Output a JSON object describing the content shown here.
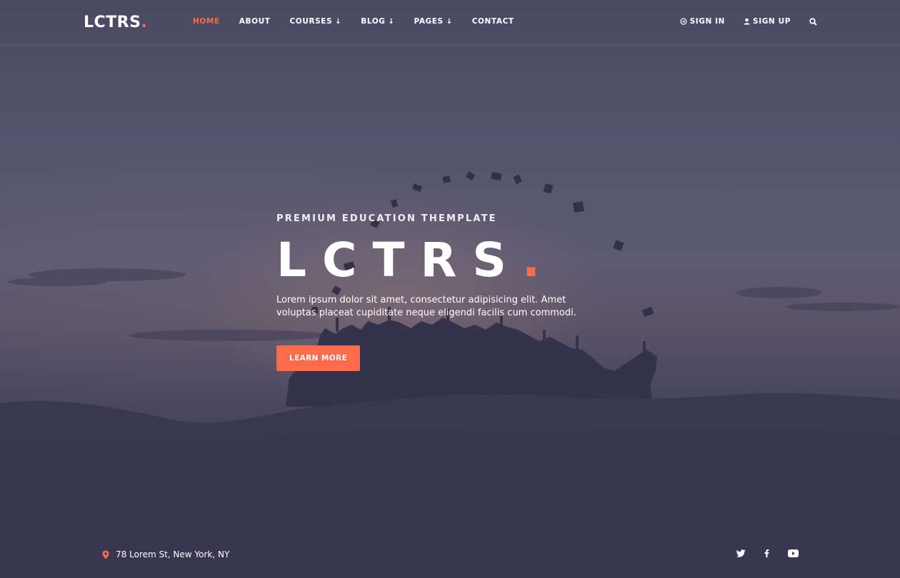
{
  "brand": {
    "name": "LCTRS",
    "dot": ".",
    "accent": "#ff6b4a"
  },
  "nav": {
    "items": [
      {
        "label": "HOME",
        "active": true
      },
      {
        "label": "ABOUT",
        "dropdown": false
      },
      {
        "label": "COURSES",
        "dropdown": true
      },
      {
        "label": "BLOG",
        "dropdown": true
      },
      {
        "label": "PAGES",
        "dropdown": true
      },
      {
        "label": "CONTACT",
        "dropdown": false
      }
    ],
    "dropdown_icon": "arrow-down-icon",
    "sign_in": {
      "label": "SIGN IN",
      "icon": "sign-in-icon"
    },
    "sign_up": {
      "label": "SIGN UP",
      "icon": "user-icon"
    },
    "search_icon": "search-icon"
  },
  "hero": {
    "subtitle": "PREMIUM EDUCATION THEMPLATE",
    "title": "LCTRS",
    "title_dot": ".",
    "description": "Lorem ipsum dolor sit amet, consectetur adipisicing elit. Amet voluptas placeat cupiditate neque eligendi facilis cum commodi.",
    "cta_label": "LEARN MORE"
  },
  "footer": {
    "address": "78 Lorem St, New York, NY",
    "address_icon": "map-pin-icon",
    "social": [
      "twitter-icon",
      "facebook-icon",
      "youtube-icon"
    ]
  }
}
